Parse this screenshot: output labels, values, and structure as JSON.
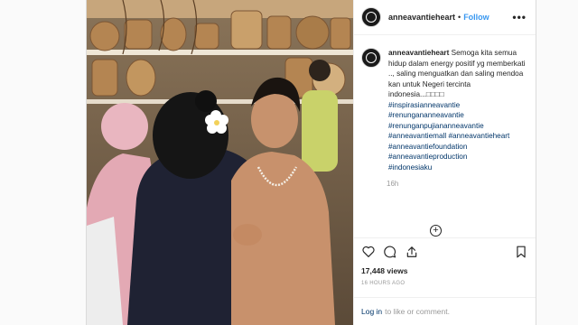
{
  "post": {
    "username": "anneavantieheart",
    "separator": "•",
    "follow_label": "Follow",
    "more_label": "•••",
    "caption": {
      "username": "anneavantieheart",
      "text": "Semoga kita semua hidup dalam energy positif yg memberkati .., saling menguatkan dan saling mendoa kan untuk Negeri tercinta indonesia...□□□□",
      "hashtags": [
        "#inspirasianneavantie",
        "#renungananneavantie",
        "#renunganpujiananneavantie",
        "#anneavantiemall #anneavantieheart",
        "#anneavantiefoundation",
        "#anneavantieproduction",
        "#indonesiaku"
      ],
      "time_ago": "16h"
    },
    "load_more_label": "+",
    "actions": {
      "like_icon": "heart-icon",
      "comment_icon": "comment-icon",
      "share_icon": "share-icon",
      "save_icon": "bookmark-icon"
    },
    "views": "17,448 views",
    "timestamp": "16 HOURS AGO",
    "login": {
      "link_label": "Log in",
      "suffix": "to like or comment."
    }
  },
  "colors": {
    "link_blue": "#3897f0",
    "hashtag_blue": "#003569",
    "text_dark": "#262626",
    "text_muted": "#999999",
    "border": "#dbdbdb"
  }
}
